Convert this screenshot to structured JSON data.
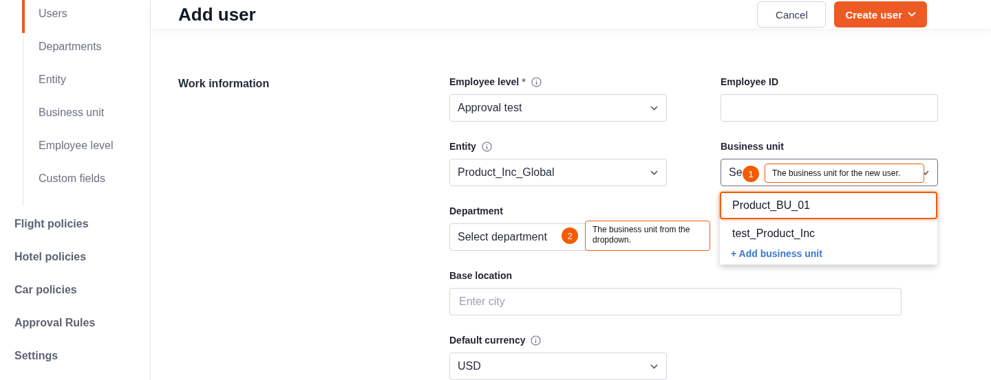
{
  "sidebar": {
    "sub_items": [
      {
        "label": "Users",
        "selected": true
      },
      {
        "label": "Departments",
        "selected": false
      },
      {
        "label": "Entity",
        "selected": false
      },
      {
        "label": "Business unit",
        "selected": false
      },
      {
        "label": "Employee level",
        "selected": false
      },
      {
        "label": "Custom fields",
        "selected": false
      }
    ],
    "items": [
      {
        "label": "Flight policies"
      },
      {
        "label": "Hotel policies"
      },
      {
        "label": "Car policies"
      },
      {
        "label": "Approval Rules"
      },
      {
        "label": "Settings"
      }
    ]
  },
  "header": {
    "title": "Add user",
    "buttons": [
      {
        "label": "Cancel",
        "kind": "secondary"
      },
      {
        "label": "Create user",
        "kind": "primary"
      }
    ]
  },
  "section": {
    "title": "Work information"
  },
  "rows": [
    [
      {
        "label": "Employee level",
        "required_mark": "*",
        "info": true,
        "kind": "select",
        "value": "Approval test"
      },
      {
        "label": "Employee ID",
        "info": false,
        "kind": "input"
      }
    ],
    [
      {
        "label": "Entity",
        "info": true,
        "kind": "select",
        "value": "Product_Inc_Global"
      },
      {
        "label": "Business unit",
        "info": false,
        "kind": "select",
        "value": "Se",
        "annotation": {
          "number": "1",
          "text": "The business unit for the new user."
        },
        "open": true,
        "options": [
          {
            "label": "Product_BU_01",
            "selected": true
          },
          {
            "label": "test_Product_Inc",
            "selected": false
          }
        ],
        "action": "+ Add business unit"
      }
    ],
    [
      {
        "label": "Department",
        "info": false,
        "kind": "select",
        "placeholder": "Select department",
        "annotation": {
          "number": "2",
          "text": "The business unit from the dropdown."
        }
      }
    ],
    [
      {
        "label": "Base location",
        "info": false,
        "kind": "input",
        "placeholder": "Enter city"
      }
    ],
    [
      {
        "label": "Default currency",
        "info": true,
        "kind": "select",
        "value": "USD"
      }
    ]
  ]
}
